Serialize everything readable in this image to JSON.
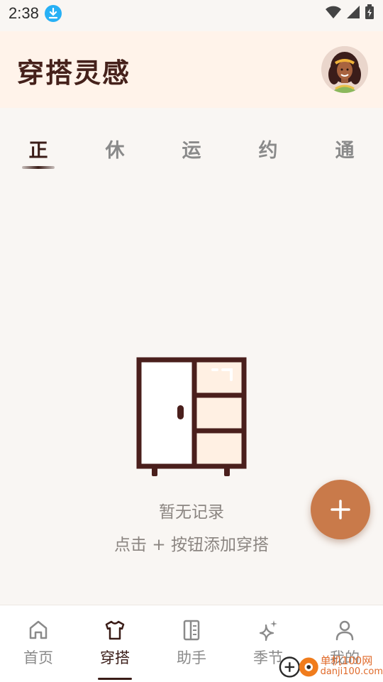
{
  "status_bar": {
    "time": "2:38"
  },
  "header": {
    "title": "穿搭灵感"
  },
  "tabs": [
    {
      "label": "正"
    },
    {
      "label": "休"
    },
    {
      "label": "运"
    },
    {
      "label": "约"
    },
    {
      "label": "通"
    }
  ],
  "empty_state": {
    "title": "暂无记录",
    "hint": "点击 + 按钮添加穿搭"
  },
  "bottom_nav": [
    {
      "label": "首页",
      "icon": "home-icon"
    },
    {
      "label": "穿搭",
      "icon": "shirt-icon"
    },
    {
      "label": "助手",
      "icon": "book-icon"
    },
    {
      "label": "季节",
      "icon": "sparkle-icon"
    },
    {
      "label": "我的",
      "icon": "person-icon"
    }
  ],
  "watermark": {
    "line1": "单机100网",
    "line2": "danji100.com"
  },
  "colors": {
    "accent": "#c97a4a",
    "brand_dark": "#3a1c17",
    "header_bg": "#fff3ea",
    "download_badge": "#27b0f5"
  }
}
